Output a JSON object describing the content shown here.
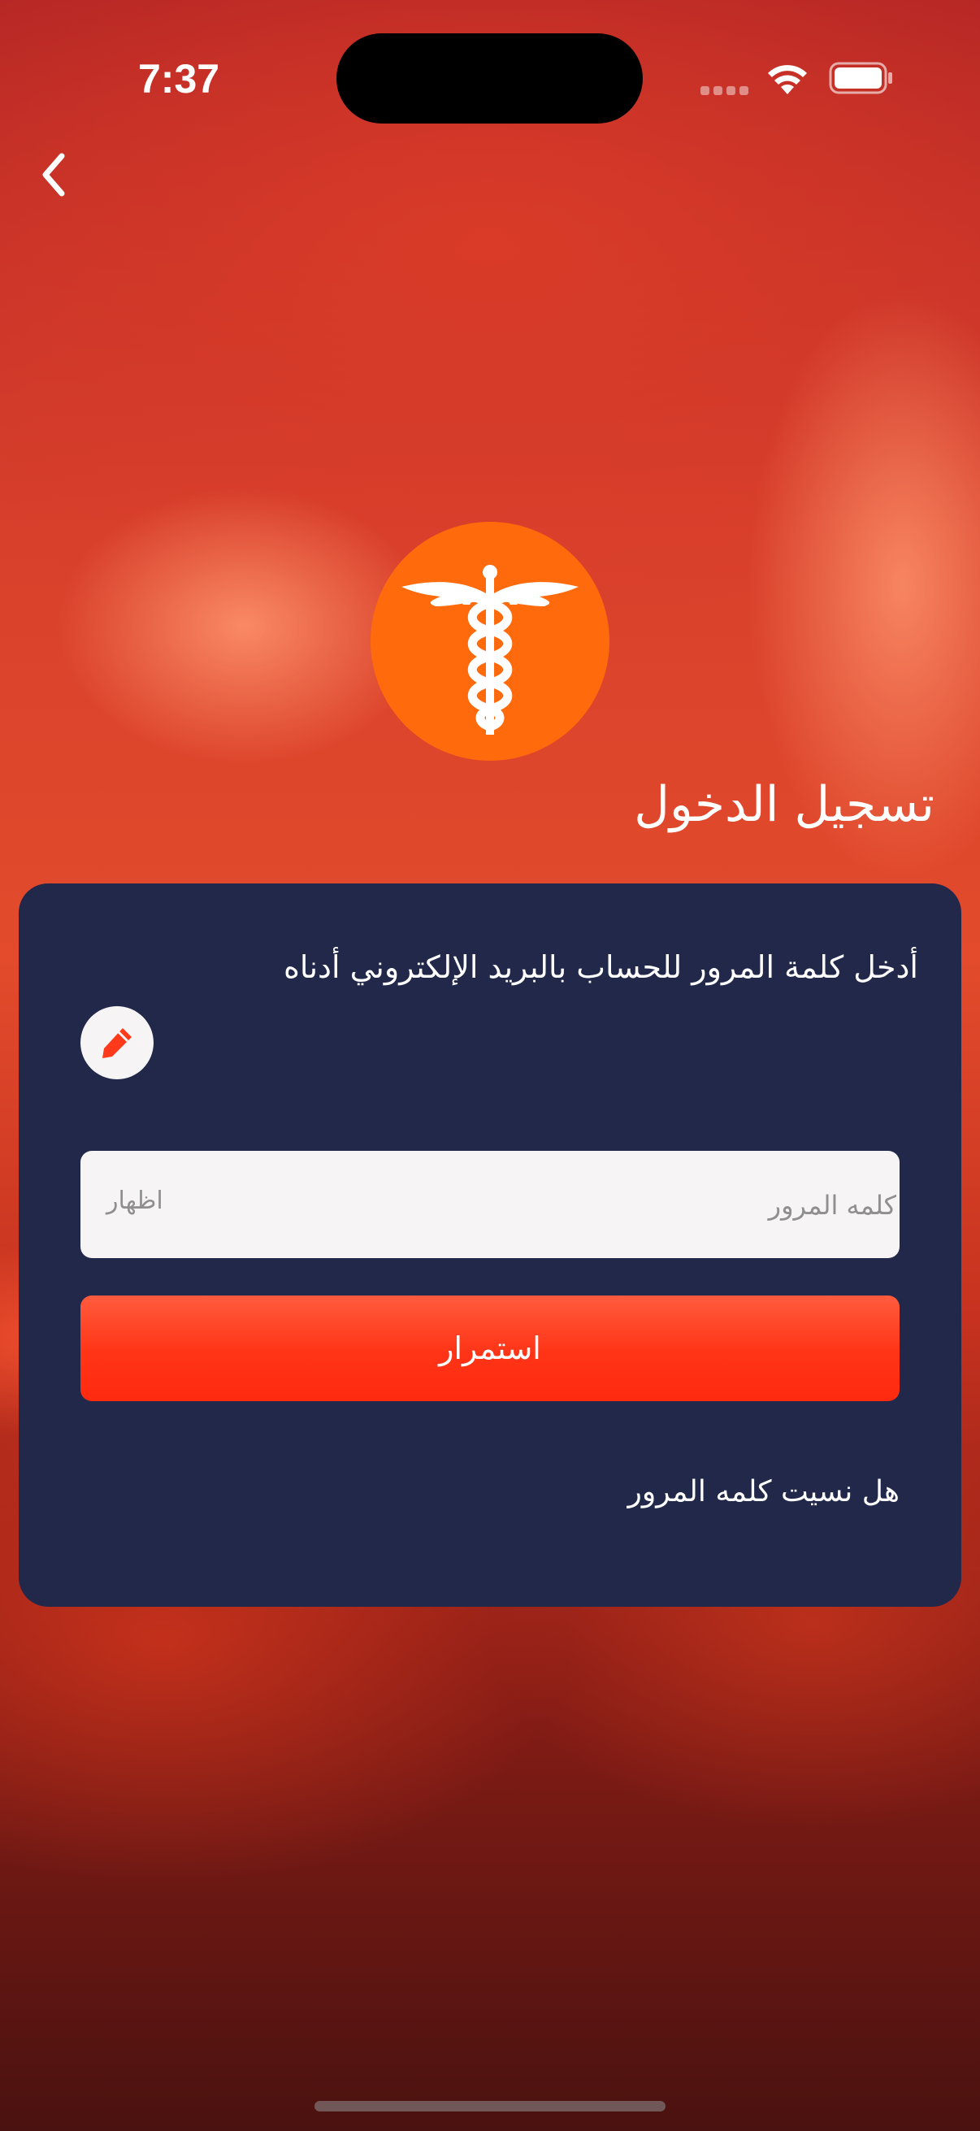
{
  "status_bar": {
    "time": "7:37"
  },
  "header": {
    "back_icon": "chevron-left-icon"
  },
  "logo": {
    "icon": "caduceus-icon",
    "background_color": "#ff6a0c"
  },
  "page": {
    "title": "تسجيل الدخول"
  },
  "card": {
    "background_color": "#21284a",
    "instruction": "أدخل كلمة المرور للحساب بالبريد الإلكتروني أدناه",
    "edit_icon": "pencil-icon",
    "password_field": {
      "placeholder": "كلمه المرور",
      "value": "",
      "show_label": "اظهار"
    },
    "continue_label": "استمرار",
    "continue_color": "#ff3416",
    "forgot_label": "هل نسيت كلمه المرور"
  }
}
